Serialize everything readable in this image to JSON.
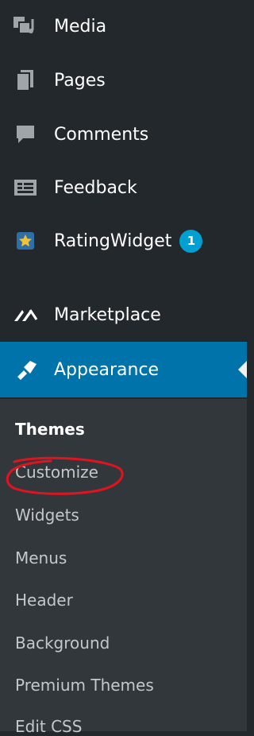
{
  "menu": {
    "items": [
      {
        "label": "Media",
        "icon": "media-icon"
      },
      {
        "label": "Pages",
        "icon": "pages-icon"
      },
      {
        "label": "Comments",
        "icon": "comments-icon"
      },
      {
        "label": "Feedback",
        "icon": "feedback-icon"
      },
      {
        "label": "RatingWidget",
        "icon": "rating-widget-icon",
        "badge": "1"
      },
      {
        "label": "Marketplace",
        "icon": "marketplace-icon"
      },
      {
        "label": "Appearance",
        "icon": "appearance-icon",
        "active": true
      }
    ]
  },
  "submenu": {
    "items": [
      {
        "label": "Themes",
        "current": true
      },
      {
        "label": "Customize",
        "annotated": true
      },
      {
        "label": "Widgets"
      },
      {
        "label": "Menus"
      },
      {
        "label": "Header"
      },
      {
        "label": "Background"
      },
      {
        "label": "Premium Themes"
      },
      {
        "label": "Edit CSS"
      }
    ]
  },
  "colors": {
    "sidebar_bg": "#23282d",
    "submenu_bg": "#32373c",
    "active_bg": "#0073aa",
    "badge_bg": "#00a0d2",
    "annotation": "#e0141e"
  }
}
